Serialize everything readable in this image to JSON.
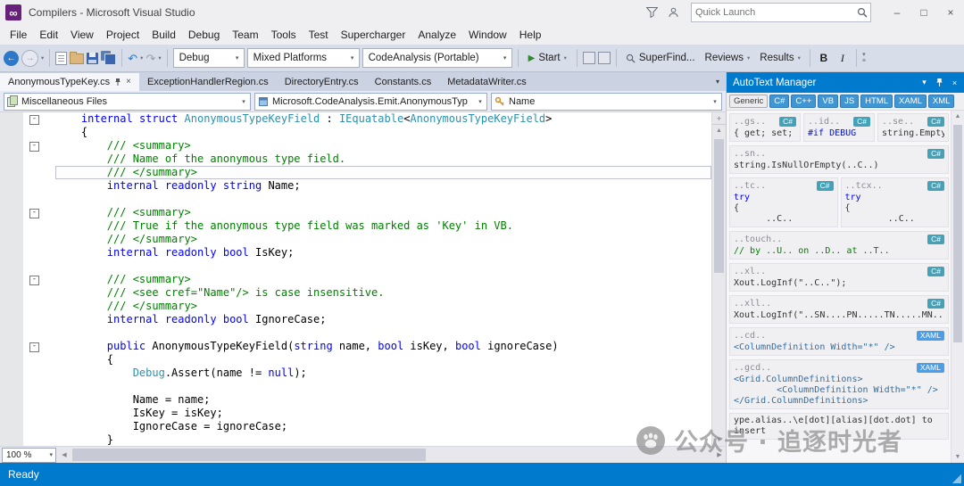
{
  "window": {
    "title": "Compilers - Microsoft Visual Studio",
    "quick_launch": "Quick Launch"
  },
  "menu": {
    "items": [
      "File",
      "Edit",
      "View",
      "Project",
      "Build",
      "Debug",
      "Team",
      "Tools",
      "Test",
      "Supercharger",
      "Analyze",
      "Window",
      "Help"
    ]
  },
  "toolbar": {
    "combos": {
      "config": "Debug",
      "platform": "Mixed Platforms",
      "startup": "CodeAnalysis (Portable)"
    },
    "start_label": "Start",
    "superfind_label": "SuperFind...",
    "reviews_label": "Reviews",
    "results_label": "Results",
    "bold_label": "B",
    "italic_label": "I"
  },
  "editor": {
    "tabs": [
      {
        "label": "AnonymousTypeKey.cs",
        "active": true
      },
      {
        "label": "ExceptionHandlerRegion.cs",
        "active": false
      },
      {
        "label": "DirectoryEntry.cs",
        "active": false
      },
      {
        "label": "Constants.cs",
        "active": false
      },
      {
        "label": "MetadataWriter.cs",
        "active": false
      }
    ],
    "navbar": {
      "scope": "Miscellaneous Files",
      "type": "Microsoft.CodeAnalysis.Emit.AnonymousTyp",
      "member": "Name"
    },
    "zoom": "100 %",
    "caret_line": 4,
    "fold_lines": [
      0,
      2,
      7,
      12,
      17
    ],
    "code_lines": [
      [
        [
          "pl",
          "    "
        ],
        [
          "kw",
          "internal"
        ],
        [
          "pl",
          " "
        ],
        [
          "kw",
          "struct"
        ],
        [
          "pl",
          " "
        ],
        [
          "ty",
          "AnonymousTypeKeyField"
        ],
        [
          "pl",
          " : "
        ],
        [
          "ty",
          "IEquatable"
        ],
        [
          "pl",
          "<"
        ],
        [
          "ty",
          "AnonymousTypeKeyField"
        ],
        [
          "pl",
          ">"
        ]
      ],
      [
        [
          "pl",
          "    {"
        ]
      ],
      [
        [
          "cm",
          "        /// <summary>"
        ]
      ],
      [
        [
          "cm",
          "        /// Name of the anonymous type field."
        ]
      ],
      [
        [
          "cm",
          "        /// </summary>"
        ]
      ],
      [
        [
          "pl",
          "        "
        ],
        [
          "kw",
          "internal"
        ],
        [
          "pl",
          " "
        ],
        [
          "kw",
          "readonly"
        ],
        [
          "pl",
          " "
        ],
        [
          "kw",
          "string"
        ],
        [
          "pl",
          " Name;"
        ]
      ],
      [],
      [
        [
          "cm",
          "        /// <summary>"
        ]
      ],
      [
        [
          "cm",
          "        /// True if the anonymous type field was marked as 'Key' in VB."
        ]
      ],
      [
        [
          "cm",
          "        /// </summary>"
        ]
      ],
      [
        [
          "pl",
          "        "
        ],
        [
          "kw",
          "internal"
        ],
        [
          "pl",
          " "
        ],
        [
          "kw",
          "readonly"
        ],
        [
          "pl",
          " "
        ],
        [
          "kw",
          "bool"
        ],
        [
          "pl",
          " IsKey;"
        ]
      ],
      [],
      [
        [
          "cm",
          "        /// <summary>"
        ]
      ],
      [
        [
          "cm",
          "        /// <see cref=\"Name\"/> is case insensitive."
        ]
      ],
      [
        [
          "cm",
          "        /// </summary>"
        ]
      ],
      [
        [
          "pl",
          "        "
        ],
        [
          "kw",
          "internal"
        ],
        [
          "pl",
          " "
        ],
        [
          "kw",
          "readonly"
        ],
        [
          "pl",
          " "
        ],
        [
          "kw",
          "bool"
        ],
        [
          "pl",
          " IgnoreCase;"
        ]
      ],
      [],
      [
        [
          "pl",
          "        "
        ],
        [
          "kw",
          "public"
        ],
        [
          "pl",
          " AnonymousTypeKeyField("
        ],
        [
          "kw",
          "string"
        ],
        [
          "pl",
          " name, "
        ],
        [
          "kw",
          "bool"
        ],
        [
          "pl",
          " isKey, "
        ],
        [
          "kw",
          "bool"
        ],
        [
          "pl",
          " ignoreCase)"
        ]
      ],
      [
        [
          "pl",
          "        {"
        ]
      ],
      [
        [
          "pl",
          "            "
        ],
        [
          "ty",
          "Debug"
        ],
        [
          "pl",
          ".Assert(name != "
        ],
        [
          "kw",
          "null"
        ],
        [
          "pl",
          ");"
        ]
      ],
      [],
      [
        [
          "pl",
          "            Name = name;"
        ]
      ],
      [
        [
          "pl",
          "            IsKey = isKey;"
        ]
      ],
      [
        [
          "pl",
          "            IgnoreCase = ignoreCase;"
        ]
      ],
      [
        [
          "pl",
          "        }"
        ]
      ]
    ]
  },
  "autotext": {
    "title": "AutoText Manager",
    "filters": [
      {
        "label": "Generic",
        "active": false
      },
      {
        "label": "C#",
        "active": true
      },
      {
        "label": "C++",
        "active": true
      },
      {
        "label": "VB",
        "active": true
      },
      {
        "label": "JS",
        "active": true
      },
      {
        "label": "HTML",
        "active": true
      },
      {
        "label": "XAML",
        "active": true
      },
      {
        "label": "XML",
        "active": true
      }
    ],
    "rows": [
      [
        {
          "title": "..gs..",
          "lang": "C#",
          "code": [
            "{ get; set; }"
          ]
        },
        {
          "title": "..id..",
          "lang": "C#",
          "code": [
            "#if DEBUG"
          ]
        },
        {
          "title": "..se..",
          "lang": "C#",
          "code": [
            "string.Empty"
          ]
        }
      ],
      [
        {
          "title": "..sn..",
          "lang": "C#",
          "code": [
            "string.IsNullOrEmpty(..C..)"
          ]
        }
      ],
      [
        {
          "title": "..tc..",
          "lang": "C#",
          "code": [
            "try",
            "{",
            "      ..C.."
          ]
        },
        {
          "title": "..tcx..",
          "lang": "C#",
          "code": [
            "try",
            "{",
            "        ..C.."
          ]
        }
      ],
      [
        {
          "title": "..touch..",
          "lang": "C#",
          "code": [
            "// by ..U.. on ..D.. at ..T.."
          ]
        }
      ],
      [
        {
          "title": "..xl..",
          "lang": "C#",
          "code": [
            "Xout.LogInf(\"..C..\");"
          ]
        }
      ],
      [
        {
          "title": "..xll..",
          "lang": "C#",
          "code": [
            "Xout.LogInf(\"..SN....PN.....TN.....MN.."
          ]
        }
      ],
      [
        {
          "title": "..cd..",
          "lang": "XAML",
          "code": [
            "<ColumnDefinition Width=\"*\" />"
          ]
        }
      ],
      [
        {
          "title": "..gcd..",
          "lang": "XAML",
          "code": [
            "<Grid.ColumnDefinitions>",
            "        <ColumnDefinition Width=\"*\" />",
            "</Grid.ColumnDefinitions>"
          ]
        }
      ],
      [
        {
          "title": "",
          "lang": "",
          "code": [
            "ype.alias..\\e[dot][alias][dot.dot] to",
            "insert"
          ]
        }
      ]
    ]
  },
  "status": {
    "ready": "Ready"
  },
  "watermark": {
    "text": "公众号 · 追逐时光者"
  },
  "colors": {
    "accent": "#007ACC",
    "keyword": "#0000FF",
    "type": "#2B91AF",
    "comment": "#008000",
    "badge_csharp": "#44A2B8",
    "badge_xaml": "#4D9EE8",
    "vs_logo": "#68217A"
  }
}
